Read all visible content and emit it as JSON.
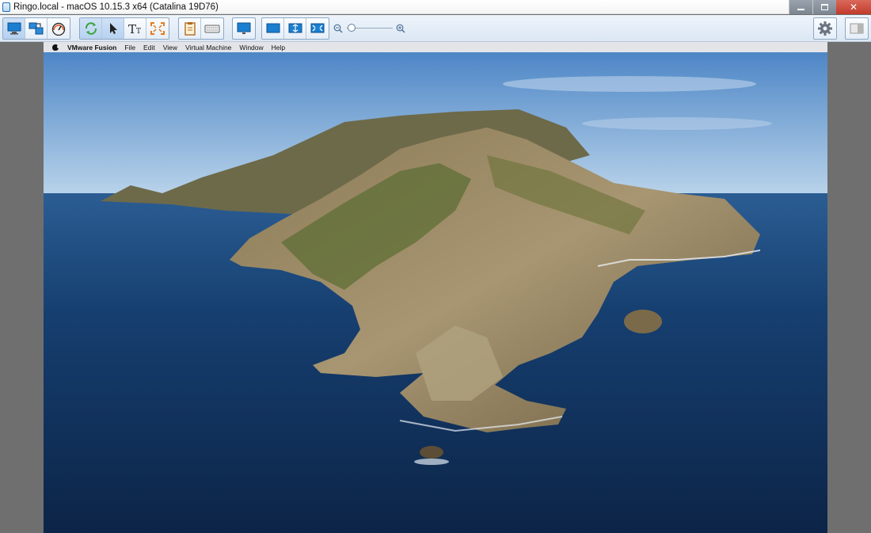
{
  "window": {
    "title": "Ringo.local - macOS 10.15.3 x64 (Catalina 19D76)",
    "controls": [
      "minimize",
      "maximize",
      "close"
    ]
  },
  "toolbar": {
    "groups": [
      [
        "console-view-icon",
        "unity-icon",
        "dashboard-icon"
      ],
      [
        "refresh-icon",
        "pointer-icon",
        "text-icon",
        "fullscreen-icon"
      ],
      [
        "clipboard-icon",
        "keyboard-icon"
      ],
      [
        "monitor-icon"
      ],
      [
        "fit-window-icon",
        "fit-guest-icon",
        "stretch-icon"
      ]
    ],
    "zoom": {
      "level": 0.1
    },
    "right_icons": [
      "gear-icon",
      "panel-icon"
    ]
  },
  "guest": {
    "menubar": {
      "app_name": "VMware Fusion",
      "items": [
        "File",
        "Edit",
        "View",
        "Virtual Machine",
        "Window",
        "Help"
      ]
    }
  },
  "colors": {
    "accent": "#1c6fb7",
    "close": "#c23a2a",
    "ocean": "#143a66",
    "sky": "#5b93cf"
  }
}
